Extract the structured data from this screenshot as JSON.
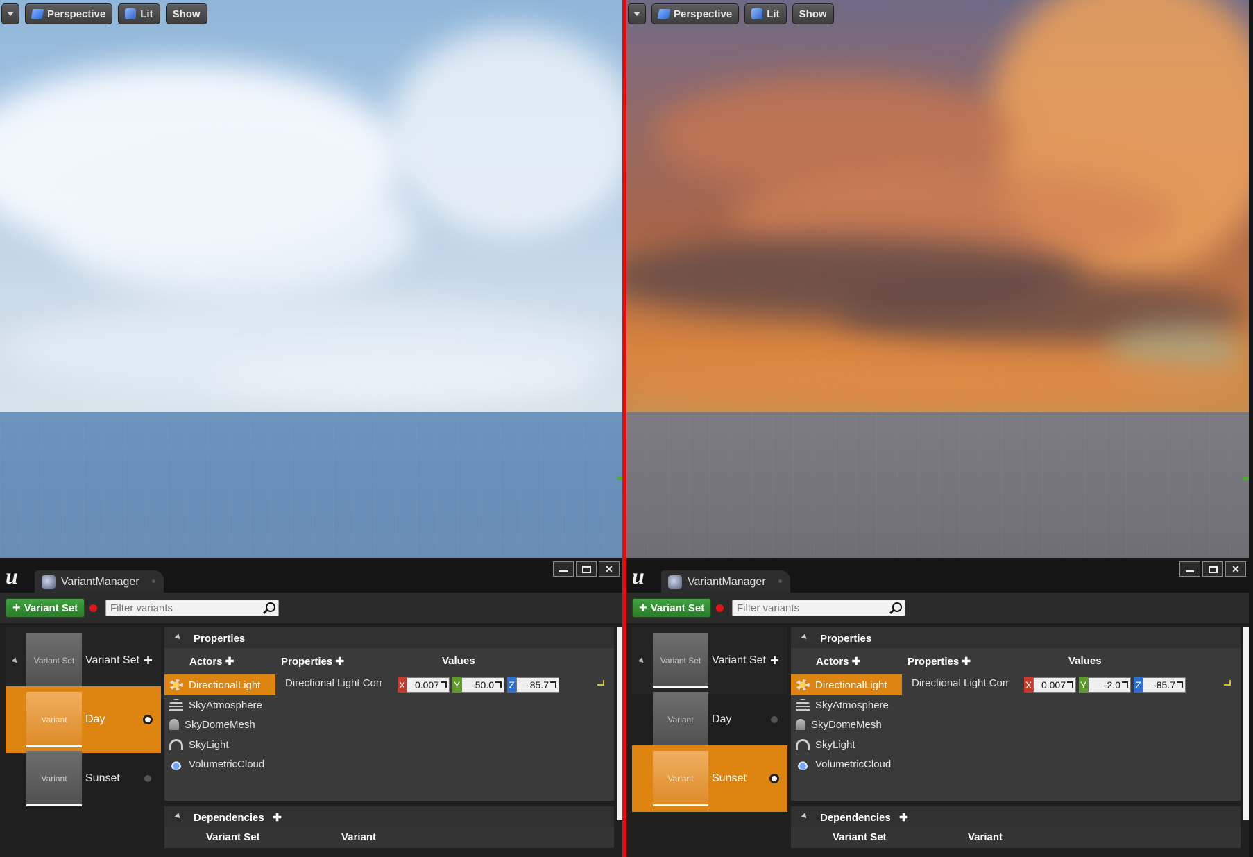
{
  "viewport": {
    "menu_icon": "chevron-down-icon",
    "perspective_label": "Perspective",
    "lit_label": "Lit",
    "show_label": "Show"
  },
  "editor": {
    "tab_label": "VariantManager",
    "logo": "u",
    "add_variant_set_label": "Variant Set",
    "filter_placeholder": "Filter variants",
    "variant_set_thumb": "Variant Set",
    "variant_set_name": "Variant Set",
    "variant_thumb": "Variant",
    "variants": [
      "Day",
      "Sunset"
    ],
    "properties_header": "Properties",
    "col_actors": "Actors",
    "col_properties": "Properties",
    "col_values": "Values",
    "actors": [
      "DirectionalLight",
      "SkyAtmosphere",
      "SkyDomeMesh",
      "SkyLight",
      "VolumetricCloud"
    ],
    "property_name": "Directional Light Component",
    "dependencies_header": "Dependencies",
    "col_variant_set": "Variant Set",
    "col_variant": "Variant"
  },
  "left_pane": {
    "selected_variant": "Day",
    "values": {
      "x": "0.007",
      "y": "-50.0",
      "z": "-85.7"
    }
  },
  "right_pane": {
    "selected_variant": "Sunset",
    "values": {
      "x": "0.007",
      "y": "-2.0",
      "z": "-85.7"
    }
  },
  "colors": {
    "accent_orange": "#de8411",
    "divider_red": "#dc1010",
    "add_button_green": "#3fa33f"
  }
}
